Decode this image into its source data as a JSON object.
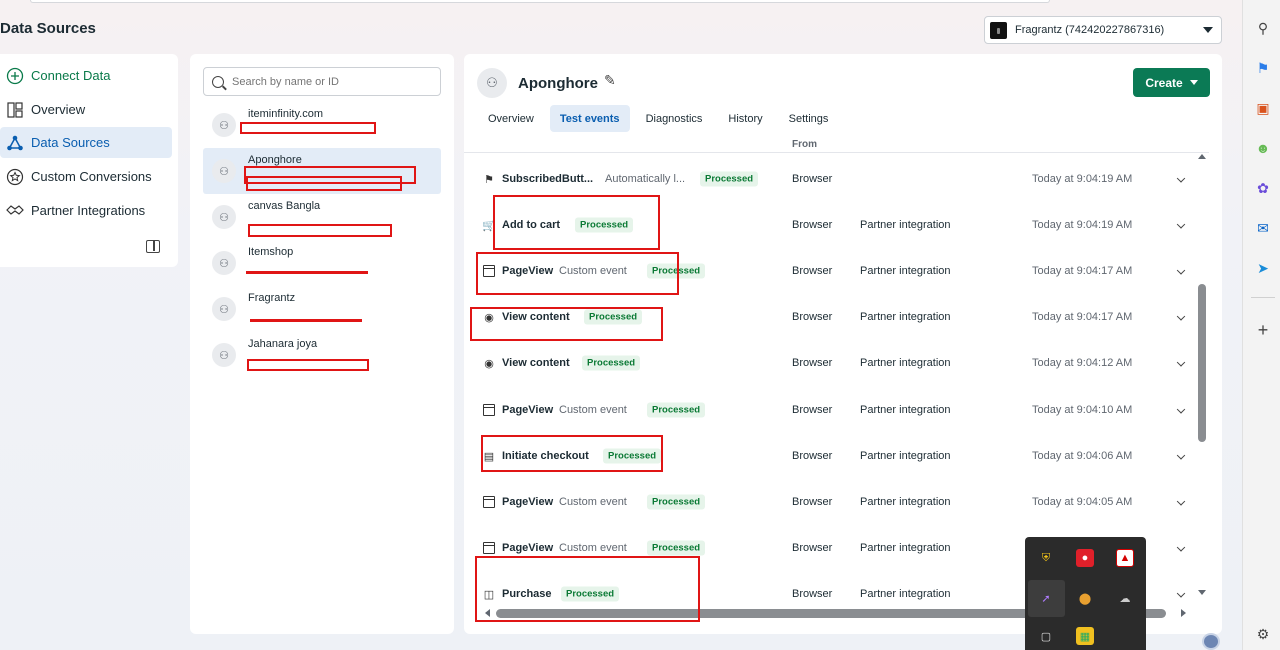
{
  "header": {
    "page_title": "Data Sources",
    "account_selector": "Fragrantz (742420227867316)"
  },
  "left_nav": {
    "items": [
      {
        "label": "Connect Data",
        "icon": "plus-circle-icon"
      },
      {
        "label": "Overview",
        "icon": "grid-icon"
      },
      {
        "label": "Data Sources",
        "icon": "data-sources-icon"
      },
      {
        "label": "Custom Conversions",
        "icon": "star-circle-icon"
      },
      {
        "label": "Partner Integrations",
        "icon": "handshake-icon"
      }
    ],
    "active_index": 2
  },
  "sources": {
    "search_placeholder": "Search by name or ID",
    "items": [
      {
        "name": "iteminfinity.com",
        "id_text": ""
      },
      {
        "name": "Aponghore",
        "id_text": ""
      },
      {
        "name": "canvas Bangla",
        "id_text": ""
      },
      {
        "name": "Itemshop",
        "id_text": ""
      },
      {
        "name": "Fragrantz",
        "id_text": ""
      },
      {
        "name": "Jahanara joya",
        "id_text": ""
      }
    ],
    "selected_index": 1
  },
  "pixel": {
    "name": "Aponghore",
    "create_label": "Create",
    "tabs": [
      "Overview",
      "Test events",
      "Diagnostics",
      "History",
      "Settings"
    ],
    "active_tab": 1
  },
  "events": {
    "header_partial": "From",
    "rows": [
      {
        "name": "SubscribedButt...",
        "sub": "Automatically l...",
        "status": "Processed",
        "source": "Browser",
        "method": "",
        "time": "Today at 9:04:19 AM",
        "icon": "tag-icon"
      },
      {
        "name": "Add to cart",
        "sub": "",
        "status": "Processed",
        "source": "Browser",
        "method": "Partner integration",
        "time": "Today at 9:04:19 AM",
        "icon": "cart-icon"
      },
      {
        "name": "PageView",
        "sub": "Custom event",
        "status": "Processed",
        "source": "Browser",
        "method": "Partner integration",
        "time": "Today at 9:04:17 AM",
        "icon": "page-icon"
      },
      {
        "name": "View content",
        "sub": "",
        "status": "Processed",
        "source": "Browser",
        "method": "Partner integration",
        "time": "Today at 9:04:17 AM",
        "icon": "eye-icon"
      },
      {
        "name": "View content",
        "sub": "",
        "status": "Processed",
        "source": "Browser",
        "method": "Partner integration",
        "time": "Today at 9:04:12 AM",
        "icon": "eye-icon"
      },
      {
        "name": "PageView",
        "sub": "Custom event",
        "status": "Processed",
        "source": "Browser",
        "method": "Partner integration",
        "time": "Today at 9:04:10 AM",
        "icon": "page-icon"
      },
      {
        "name": "Initiate checkout",
        "sub": "",
        "status": "Processed",
        "source": "Browser",
        "method": "Partner integration",
        "time": "Today at 9:04:06 AM",
        "icon": "basket-icon"
      },
      {
        "name": "PageView",
        "sub": "Custom event",
        "status": "Processed",
        "source": "Browser",
        "method": "Partner integration",
        "time": "Today at 9:04:05 AM",
        "icon": "page-icon"
      },
      {
        "name": "PageView",
        "sub": "Custom event",
        "status": "Processed",
        "source": "Browser",
        "method": "Partner integration",
        "time": "",
        "icon": "page-icon"
      },
      {
        "name": "Purchase",
        "sub": "",
        "status": "Processed",
        "source": "Browser",
        "method": "Partner integration",
        "time": "",
        "icon": "bag-icon"
      }
    ]
  },
  "colors": {
    "accent_blue": "#0a5eb0",
    "create_green": "#0b7a55",
    "processed_green": "#0b7a35",
    "annotation_red": "#e01515"
  }
}
